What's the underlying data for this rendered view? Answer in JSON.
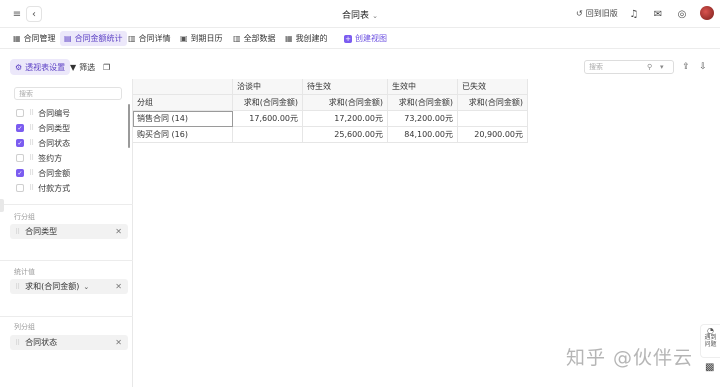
{
  "topbar": {
    "title": "合同表",
    "back_old_label": "回到旧版",
    "icons": [
      "menu-icon",
      "back-icon",
      "undo-icon",
      "bell-icon",
      "inbox-icon",
      "compass-icon",
      "avatar"
    ]
  },
  "tabs": [
    {
      "label": "合同管理",
      "icon": "table-icon",
      "active": false
    },
    {
      "label": "合同金额统计",
      "icon": "pivot-icon",
      "active": true
    },
    {
      "label": "合同详情",
      "icon": "grid-icon",
      "active": false
    },
    {
      "label": "到期日历",
      "icon": "calendar-icon",
      "active": false
    },
    {
      "label": "全部数据",
      "icon": "grid-icon",
      "active": false
    },
    {
      "label": "我创建的",
      "icon": "table-icon",
      "active": false
    },
    {
      "label": "创建视图",
      "icon": "plus-icon",
      "active": false
    }
  ],
  "toolbar": {
    "pivot_settings_label": "透视表设置",
    "filter_label": "筛选",
    "search_placeholder": "搜索"
  },
  "panel": {
    "search_placeholder": "搜索",
    "fields": [
      {
        "label": "合同编号",
        "checked": false
      },
      {
        "label": "合同类型",
        "checked": true
      },
      {
        "label": "合同状态",
        "checked": true
      },
      {
        "label": "签约方",
        "checked": false
      },
      {
        "label": "合同金额",
        "checked": true
      },
      {
        "label": "付款方式",
        "checked": false
      }
    ],
    "row_group_label": "行分组",
    "row_group_chip": "合同类型",
    "value_label": "统计值",
    "value_chip": "求和(合同金额)",
    "col_group_label": "列分组",
    "col_group_chip": "合同状态"
  },
  "pivot": {
    "status_headers": [
      "洽谈中",
      "待生效",
      "生效中",
      "已失效"
    ],
    "group_header": "分组",
    "measure_header": "求和(合同金额)",
    "rows": [
      {
        "group": "销售合同 (14)",
        "values": [
          "17,600.00元",
          "17,200.00元",
          "73,200.00元",
          ""
        ]
      },
      {
        "group": "购买合同 (16)",
        "values": [
          "",
          "25,600.00元",
          "84,100.00元",
          "20,900.00元"
        ]
      }
    ]
  },
  "float": {
    "help_label_1": "遇到",
    "help_label_2": "问题"
  },
  "watermark": "知乎 @伙伴云"
}
